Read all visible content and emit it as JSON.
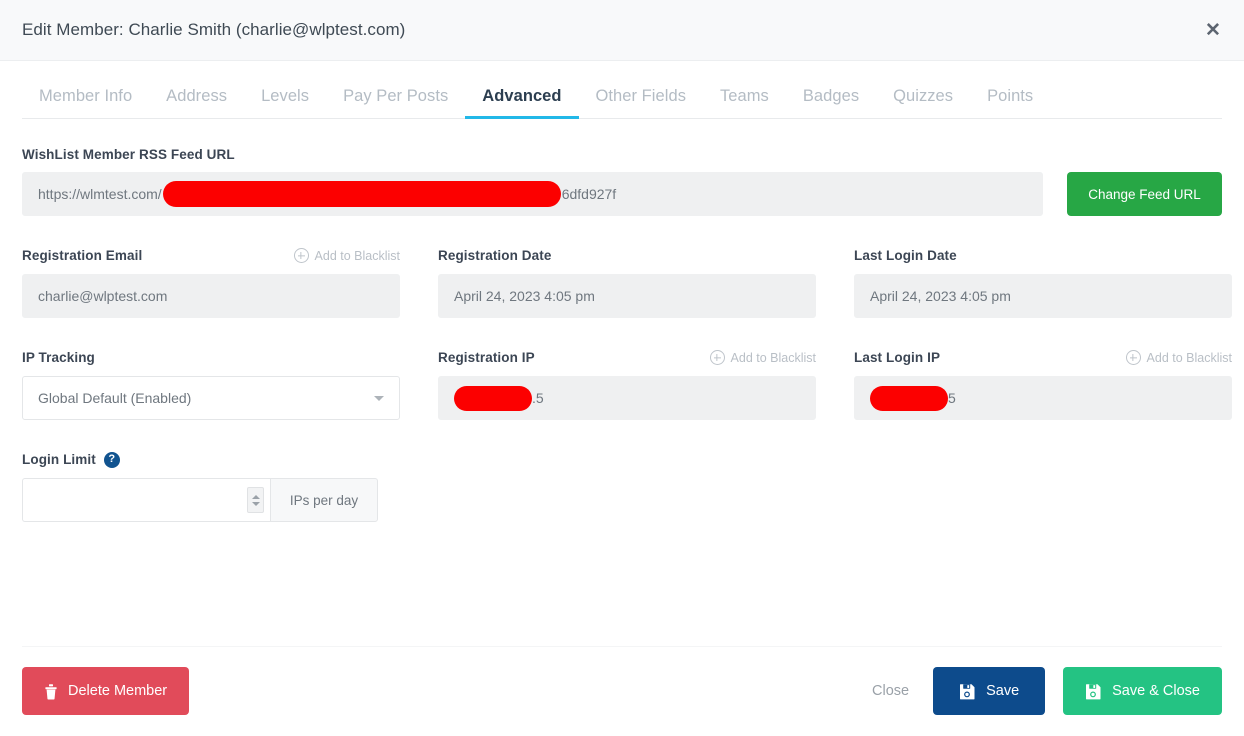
{
  "header": {
    "title": "Edit Member: Charlie Smith (charlie@wlptest.com)",
    "close_icon": "close-icon"
  },
  "tabs": [
    {
      "label": "Member Info",
      "active": false
    },
    {
      "label": "Address",
      "active": false
    },
    {
      "label": "Levels",
      "active": false
    },
    {
      "label": "Pay Per Posts",
      "active": false
    },
    {
      "label": "Advanced",
      "active": true
    },
    {
      "label": "Other Fields",
      "active": false
    },
    {
      "label": "Teams",
      "active": false
    },
    {
      "label": "Badges",
      "active": false
    },
    {
      "label": "Quizzes",
      "active": false
    },
    {
      "label": "Points",
      "active": false
    }
  ],
  "rss": {
    "label": "WishList Member RSS Feed URL",
    "url_prefix": "https://wlmtest.com/",
    "url_suffix": "6dfd927f",
    "redacted": true,
    "button_label": "Change Feed URL"
  },
  "blacklist_link_label": "Add to Blacklist",
  "fields": {
    "registration_email": {
      "label": "Registration Email",
      "value": "charlie@wlptest.com",
      "has_blacklist": true
    },
    "registration_date": {
      "label": "Registration Date",
      "value": "April 24, 2023 4:05 pm",
      "has_blacklist": false
    },
    "last_login_date": {
      "label": "Last Login Date",
      "value": "April 24, 2023 4:05 pm",
      "has_blacklist": false
    },
    "ip_tracking": {
      "label": "IP Tracking",
      "value": "Global Default (Enabled)",
      "options": [
        "Global Default (Enabled)"
      ]
    },
    "registration_ip": {
      "label": "Registration IP",
      "value_suffix": ".5",
      "redacted": true,
      "has_blacklist": true
    },
    "last_login_ip": {
      "label": "Last Login IP",
      "value_suffix": "5",
      "redacted": true,
      "has_blacklist": true
    },
    "login_limit": {
      "label": "Login Limit",
      "help_glyph": "?",
      "value": "",
      "placeholder": "",
      "suffix": "IPs per day"
    }
  },
  "footer": {
    "delete_label": "Delete Member",
    "close_label": "Close",
    "save_label": "Save",
    "save_close_label": "Save & Close"
  },
  "colors": {
    "accent_tab": "#22b8e8",
    "green": "#27a745",
    "delete_red": "#e14b5a",
    "save_blue": "#0d4b8c",
    "save_close_green": "#24c383",
    "redaction": "#fc0000",
    "help_blue": "#11538f"
  }
}
